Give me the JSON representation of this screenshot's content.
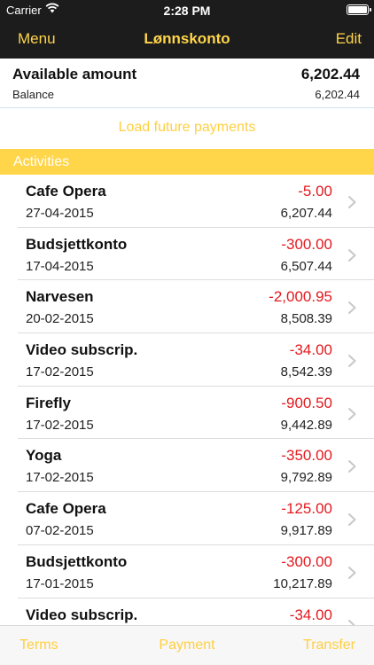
{
  "status_bar": {
    "carrier": "Carrier",
    "time": "2:28 PM"
  },
  "navbar": {
    "menu_label": "Menu",
    "title": "Lønnskonto",
    "edit_label": "Edit"
  },
  "summary": {
    "available_label": "Available amount",
    "available_value": "6,202.44",
    "balance_label": "Balance",
    "balance_value": "6,202.44"
  },
  "load_future_label": "Load future payments",
  "section_title": "Activities",
  "transactions": [
    {
      "name": "Cafe Opera",
      "date": "27-04-2015",
      "amount": "-5.00",
      "balance": "6,207.44"
    },
    {
      "name": "Budsjettkonto",
      "date": "17-04-2015",
      "amount": "-300.00",
      "balance": "6,507.44"
    },
    {
      "name": "Narvesen",
      "date": "20-02-2015",
      "amount": "-2,000.95",
      "balance": "8,508.39"
    },
    {
      "name": "Video subscrip.",
      "date": "17-02-2015",
      "amount": "-34.00",
      "balance": "8,542.39"
    },
    {
      "name": "Firefly",
      "date": "17-02-2015",
      "amount": "-900.50",
      "balance": "9,442.89"
    },
    {
      "name": "Yoga",
      "date": "17-02-2015",
      "amount": "-350.00",
      "balance": "9,792.89"
    },
    {
      "name": "Cafe Opera",
      "date": "07-02-2015",
      "amount": "-125.00",
      "balance": "9,917.89"
    },
    {
      "name": "Budsjettkonto",
      "date": "17-01-2015",
      "amount": "-300.00",
      "balance": "10,217.89"
    },
    {
      "name": "Video subscrip.",
      "date": "",
      "amount": "-34.00",
      "balance": ""
    }
  ],
  "tabbar": {
    "terms_label": "Terms",
    "payment_label": "Payment",
    "transfer_label": "Transfer"
  },
  "colors": {
    "accent": "#ffd54a",
    "negative": "#e3191f",
    "nav_background": "#1c1c1c"
  }
}
